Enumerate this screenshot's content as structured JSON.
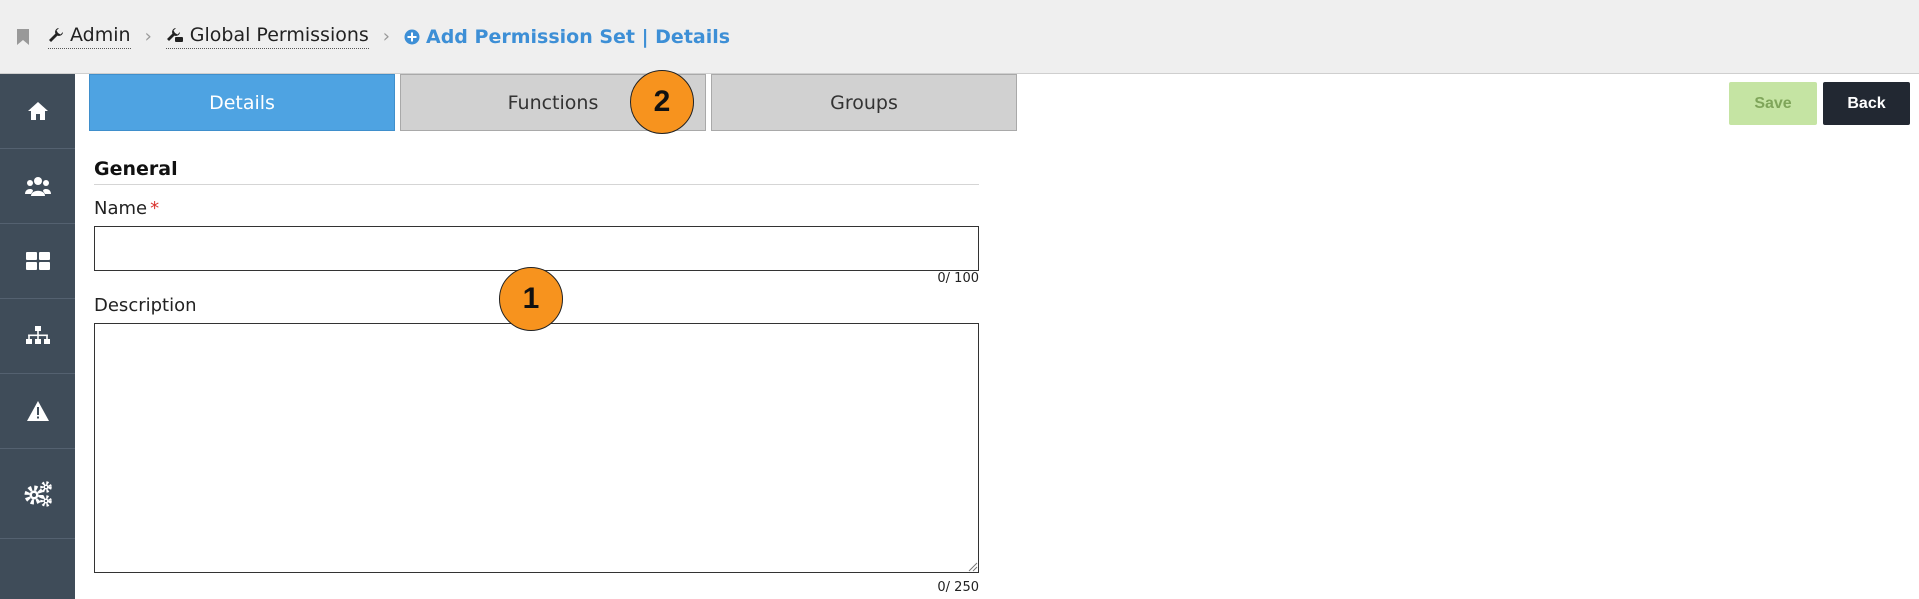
{
  "breadcrumb": {
    "items": [
      {
        "label": "Admin",
        "icon": "wrench-icon"
      },
      {
        "label": "Global Permissions",
        "icon": "wrench-hand-icon"
      }
    ],
    "current": {
      "label": "Add Permission Set | Details",
      "icon": "plus-circle-icon"
    }
  },
  "sidebar": {
    "items": [
      {
        "icon": "home-icon"
      },
      {
        "icon": "users-icon"
      },
      {
        "icon": "dashboard-icon"
      },
      {
        "icon": "hierarchy-icon"
      },
      {
        "icon": "warning-icon"
      },
      {
        "icon": "gears-icon"
      }
    ]
  },
  "tabs": [
    {
      "label": "Details",
      "active": true
    },
    {
      "label": "Functions",
      "active": false
    },
    {
      "label": "Groups",
      "active": false
    }
  ],
  "actions": {
    "save_label": "Save",
    "back_label": "Back"
  },
  "form": {
    "section_title": "General",
    "name": {
      "label": "Name",
      "required_mark": "*",
      "value": "",
      "counter": "0/ 100"
    },
    "description": {
      "label": "Description",
      "value": "",
      "counter": "0/ 250"
    }
  },
  "callouts": [
    "1",
    "2"
  ],
  "colors": {
    "accent": "#4ea3e2",
    "sidebar": "#3f4c59",
    "callout": "#f7931e",
    "save": "#c5e4a3",
    "back": "#222832"
  }
}
